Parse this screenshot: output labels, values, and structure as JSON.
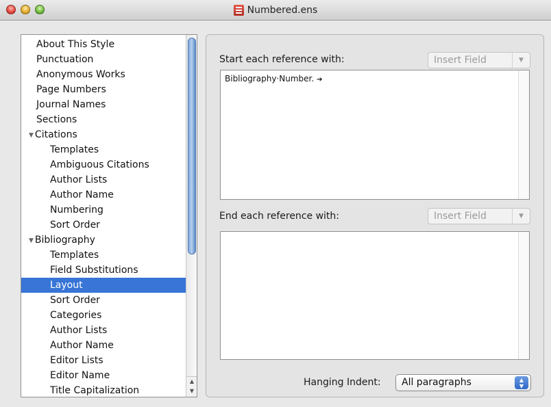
{
  "window": {
    "title": "Numbered.ens"
  },
  "sidebar": {
    "items": [
      {
        "label": "About This Style",
        "level": 0
      },
      {
        "label": "Punctuation",
        "level": 0
      },
      {
        "label": "Anonymous Works",
        "level": 0
      },
      {
        "label": "Page Numbers",
        "level": 0
      },
      {
        "label": "Journal Names",
        "level": 0
      },
      {
        "label": "Sections",
        "level": 0
      },
      {
        "label": "Citations",
        "level": 0,
        "group": true,
        "expanded": true
      },
      {
        "label": "Templates",
        "level": 1
      },
      {
        "label": "Ambiguous Citations",
        "level": 1
      },
      {
        "label": "Author Lists",
        "level": 1
      },
      {
        "label": "Author Name",
        "level": 1
      },
      {
        "label": "Numbering",
        "level": 1
      },
      {
        "label": "Sort Order",
        "level": 1
      },
      {
        "label": "Bibliography",
        "level": 0,
        "group": true,
        "expanded": true
      },
      {
        "label": "Templates",
        "level": 1
      },
      {
        "label": "Field Substitutions",
        "level": 1
      },
      {
        "label": "Layout",
        "level": 1,
        "selected": true
      },
      {
        "label": "Sort Order",
        "level": 1
      },
      {
        "label": "Categories",
        "level": 1
      },
      {
        "label": "Author Lists",
        "level": 1
      },
      {
        "label": "Author Name",
        "level": 1
      },
      {
        "label": "Editor Lists",
        "level": 1
      },
      {
        "label": "Editor Name",
        "level": 1
      },
      {
        "label": "Title Capitalization",
        "level": 1
      }
    ]
  },
  "main": {
    "start_label": "Start each reference with:",
    "start_insert": "Insert Field",
    "start_text": "Bibliography·Number.",
    "end_label": "End each reference with:",
    "end_insert": "Insert Field",
    "end_text": "",
    "hanging_label": "Hanging Indent:",
    "hanging_value": "All paragraphs"
  },
  "colors": {
    "selection": "#3875d7",
    "accent": "#2f68c7"
  }
}
